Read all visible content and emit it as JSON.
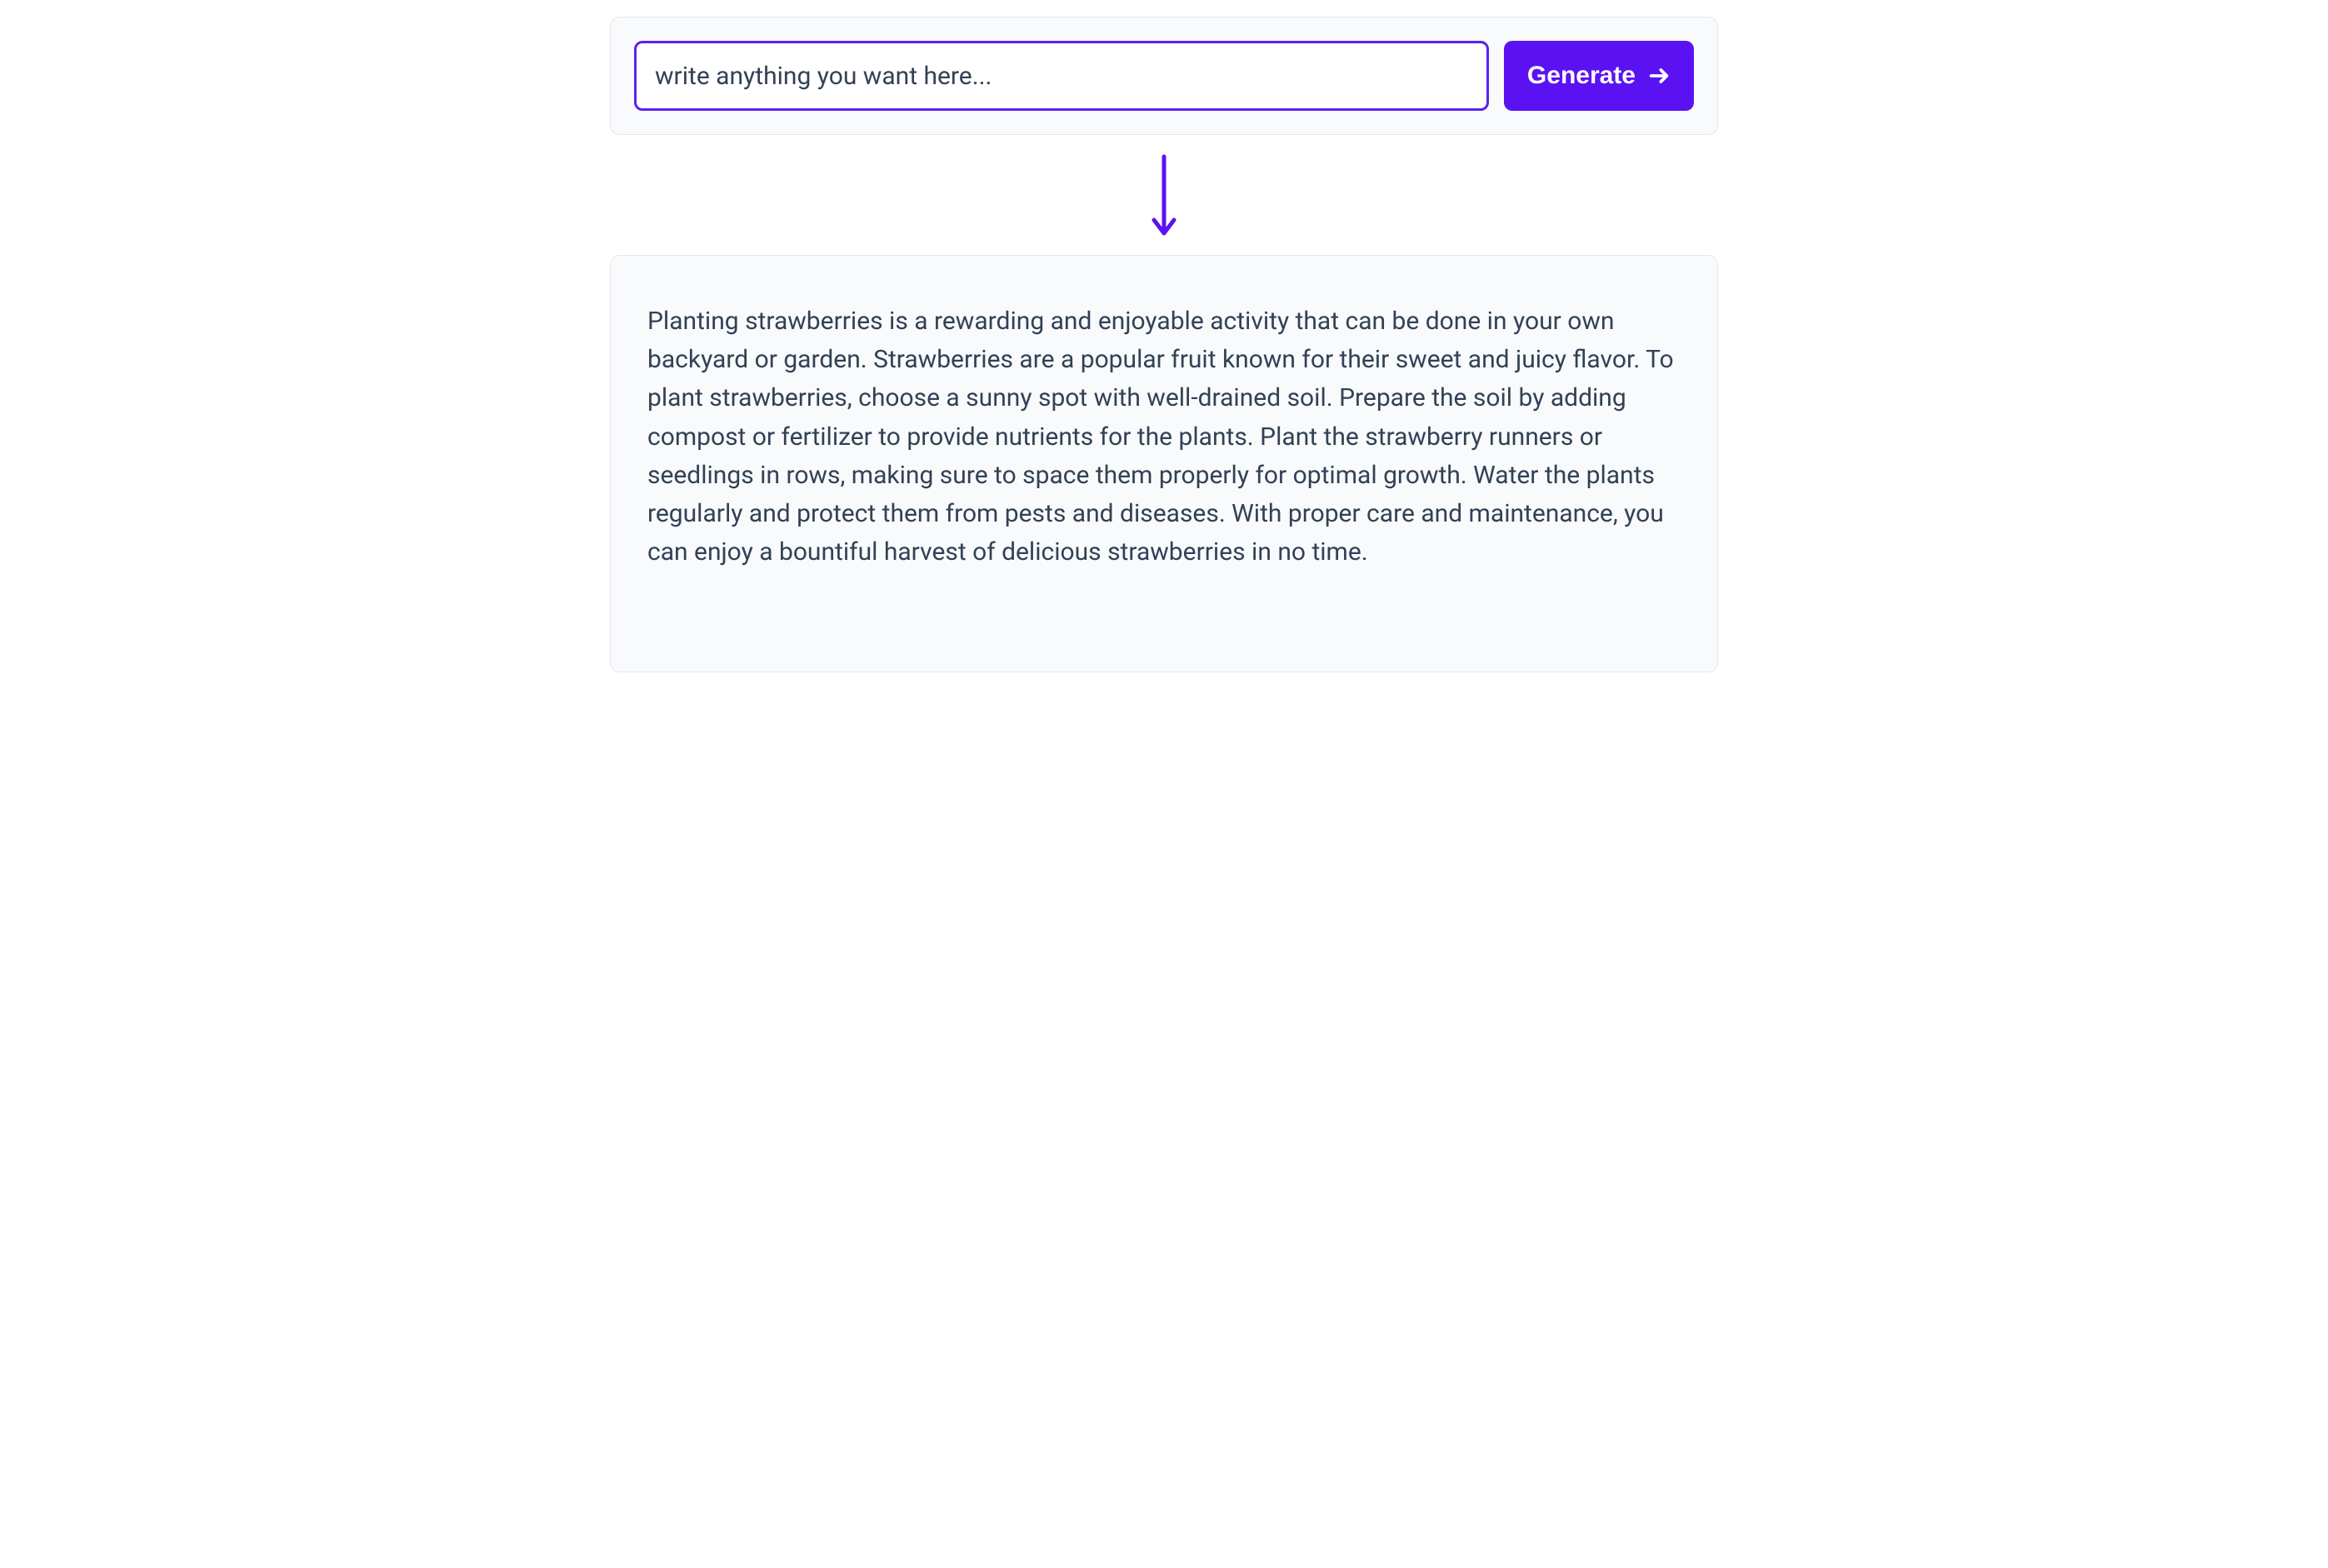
{
  "input_row": {
    "prompt_placeholder": "write anything you want here...",
    "prompt_value": "",
    "generate_label": "Generate"
  },
  "output": {
    "text": "Planting strawberries is a rewarding and enjoyable activity that can be done in your own backyard or garden. Strawberries are a popular fruit known for their sweet and juicy flavor. To plant strawberries, choose a sunny spot with well-drained soil. Prepare the soil by adding compost or fertilizer to provide nutrients for the plants. Plant the strawberry runners or seedlings in rows, making sure to space them properly for optimal growth. Water the plants regularly and protect them from pests and diseases. With proper care and maintenance, you can enjoy a bountiful harvest of delicious strawberries in no time."
  },
  "colors": {
    "accent": "#5b12f3",
    "input_border": "#5b21ef",
    "panel_bg": "#f8fafc",
    "panel_border": "#e5e7eb",
    "text_body": "#334155"
  }
}
